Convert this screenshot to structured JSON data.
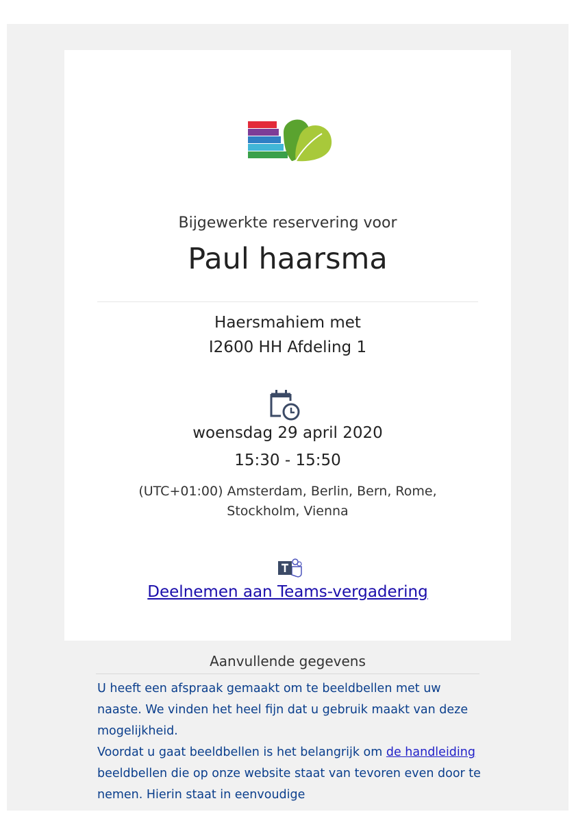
{
  "header": {
    "logo_icon": "organization-logo-icon",
    "subtitle": "Bijgewerkte reservering voor",
    "name": "Paul haarsma"
  },
  "location": {
    "line1": "Haersmahiem met",
    "line2": "I2600 HH Afdeling 1"
  },
  "schedule": {
    "calendar_icon": "calendar-clock-icon",
    "date": "woensdag 29 april 2020",
    "time": "15:30 - 15:50",
    "timezone": "(UTC+01:00) Amsterdam, Berlin, Bern, Rome, Stockholm, Vienna"
  },
  "meeting": {
    "teams_icon": "teams-icon",
    "link_label": "Deelnemen aan Teams-vergadering"
  },
  "additional": {
    "title": "Aanvullende gegevens",
    "paragraph1": "U heeft een afspraak gemaakt om te beeldbellen met uw naaste. We vinden het heel fijn dat u gebruik maakt van deze mogelijkheid.",
    "paragraph2_before": "Voordat u gaat beeldbellen is het belangrijk om ",
    "paragraph2_link": "de handleiding",
    "paragraph2_after": " beeldbellen die op onze website staat van tevoren even door te nemen. Hierin staat in eenvoudige"
  },
  "colors": {
    "link": "#1a0dab",
    "body_text": "#0a3e8c",
    "logo_green_light": "#a8c93a",
    "logo_green_dark": "#5aa32f",
    "logo_red": "#e32b3a",
    "logo_purple": "#7d3c97",
    "logo_blue": "#2f7fc4",
    "logo_cyan": "#41b6d7",
    "logo_green_bar": "#3aa04a",
    "teams_purple": "#4b53bc"
  }
}
